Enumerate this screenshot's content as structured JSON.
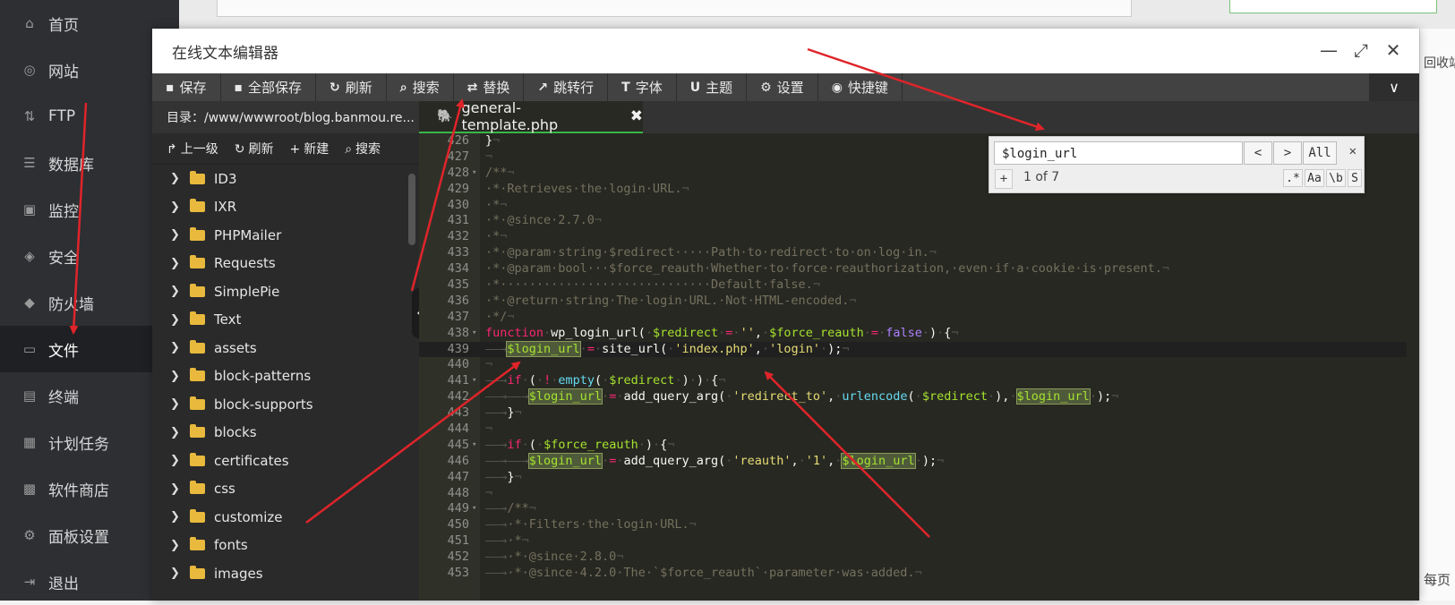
{
  "nav": [
    {
      "label": "首页",
      "icon": "home-icon",
      "glyph": "⌂"
    },
    {
      "label": "网站",
      "icon": "globe-icon",
      "glyph": "◎"
    },
    {
      "label": "FTP",
      "icon": "ftp-icon",
      "glyph": "⇅"
    },
    {
      "label": "数据库",
      "icon": "database-icon",
      "glyph": "☰"
    },
    {
      "label": "监控",
      "icon": "monitor-icon",
      "glyph": "▣"
    },
    {
      "label": "安全",
      "icon": "shield-icon",
      "glyph": "◈"
    },
    {
      "label": "防火墙",
      "icon": "firewall-icon",
      "glyph": "◆"
    },
    {
      "label": "文件",
      "icon": "folder-icon",
      "glyph": "▭"
    },
    {
      "label": "终端",
      "icon": "terminal-icon",
      "glyph": "▤"
    },
    {
      "label": "计划任务",
      "icon": "calendar-icon",
      "glyph": "▦"
    },
    {
      "label": "软件商店",
      "icon": "apps-icon",
      "glyph": "▩"
    },
    {
      "label": "面板设置",
      "icon": "gear-icon",
      "glyph": "⚙"
    },
    {
      "label": "退出",
      "icon": "logout-icon",
      "glyph": "⇥"
    }
  ],
  "window": {
    "title": "在线文本编辑器"
  },
  "toolbar": [
    {
      "label": "保存",
      "icon": "save-icon",
      "glyph": "▪"
    },
    {
      "label": "全部保存",
      "icon": "save-all-icon",
      "glyph": "▪"
    },
    {
      "label": "刷新",
      "icon": "refresh-icon",
      "glyph": "↻"
    },
    {
      "label": "搜索",
      "icon": "search-icon",
      "glyph": "⌕"
    },
    {
      "label": "替换",
      "icon": "replace-icon",
      "glyph": "⇄"
    },
    {
      "label": "跳转行",
      "icon": "goto-line-icon",
      "glyph": "↗"
    },
    {
      "label": "字体",
      "icon": "font-icon",
      "glyph": "T"
    },
    {
      "label": "主题",
      "icon": "theme-icon",
      "glyph": "U"
    },
    {
      "label": "设置",
      "icon": "settings-icon",
      "glyph": "⚙"
    },
    {
      "label": "快捷键",
      "icon": "shortcut-icon",
      "glyph": "◉"
    }
  ],
  "sidebar": {
    "dir_label": "目录：/www/wwwroot/blog.banmou.re...",
    "buttons": [
      {
        "label": "上一级",
        "icon": "up-level-icon",
        "glyph": "↱"
      },
      {
        "label": "刷新",
        "icon": "refresh-icon",
        "glyph": "↻"
      },
      {
        "label": "新建",
        "icon": "plus-icon",
        "glyph": "+"
      },
      {
        "label": "搜索",
        "icon": "search-icon",
        "glyph": "⌕"
      }
    ],
    "folders": [
      "ID3",
      "IXR",
      "PHPMailer",
      "Requests",
      "SimplePie",
      "Text",
      "assets",
      "block-patterns",
      "block-supports",
      "blocks",
      "certificates",
      "css",
      "customize",
      "fonts",
      "images"
    ]
  },
  "tab": {
    "filename": "general-template.php",
    "close": "✖"
  },
  "search": {
    "query": "$login_url",
    "count": "1 of 7",
    "prev": "<",
    "next": ">",
    "all": "All",
    "close": "✕",
    "plus": "+",
    "regex": ".*",
    "case": "Aa",
    "word": "\\b",
    "sel": "S"
  },
  "code_lines": [
    {
      "n": "426",
      "fold": "",
      "active": false,
      "t": [
        [
          "",
          "}"
        ],
        [
          "c-ws",
          "¬"
        ]
      ]
    },
    {
      "n": "427",
      "fold": "",
      "active": false,
      "t": [
        [
          "c-ws",
          "¬"
        ]
      ]
    },
    {
      "n": "428",
      "fold": "▾",
      "active": false,
      "t": [
        [
          "c-cm",
          "/**"
        ],
        [
          "c-ws",
          "¬"
        ]
      ]
    },
    {
      "n": "429",
      "fold": "",
      "active": false,
      "t": [
        [
          "c-cm",
          "·*·Retrieves·the·login·URL."
        ],
        [
          "c-ws",
          "¬"
        ]
      ]
    },
    {
      "n": "430",
      "fold": "",
      "active": false,
      "t": [
        [
          "c-cm",
          "·*"
        ],
        [
          "c-ws",
          "¬"
        ]
      ]
    },
    {
      "n": "431",
      "fold": "",
      "active": false,
      "t": [
        [
          "c-cm",
          "·*·@since·2.7.0"
        ],
        [
          "c-ws",
          "¬"
        ]
      ]
    },
    {
      "n": "432",
      "fold": "",
      "active": false,
      "t": [
        [
          "c-cm",
          "·*"
        ],
        [
          "c-ws",
          "¬"
        ]
      ]
    },
    {
      "n": "433",
      "fold": "",
      "active": false,
      "t": [
        [
          "c-cm",
          "·*·@param·string·$redirect·····Path·to·redirect·to·on·log·in."
        ],
        [
          "c-ws",
          "¬"
        ]
      ]
    },
    {
      "n": "434",
      "fold": "",
      "active": false,
      "t": [
        [
          "c-cm",
          "·*·@param·bool···$force_reauth·Whether·to·force·reauthorization,·even·if·a·cookie·is·present."
        ],
        [
          "c-ws",
          "¬"
        ]
      ]
    },
    {
      "n": "435",
      "fold": "",
      "active": false,
      "t": [
        [
          "c-cm",
          "·*·····························Default·false."
        ],
        [
          "c-ws",
          "¬"
        ]
      ]
    },
    {
      "n": "436",
      "fold": "",
      "active": false,
      "t": [
        [
          "c-cm",
          "·*·@return·string·The·login·URL.·Not·HTML-encoded."
        ],
        [
          "c-ws",
          "¬"
        ]
      ]
    },
    {
      "n": "437",
      "fold": "",
      "active": false,
      "t": [
        [
          "c-cm",
          "·*/"
        ],
        [
          "c-ws",
          "¬"
        ]
      ]
    },
    {
      "n": "438",
      "fold": "▾",
      "active": false,
      "t": [
        [
          "c-kw",
          "function"
        ],
        [
          "c-ws",
          "·"
        ],
        [
          "",
          "wp_login_url("
        ],
        [
          "c-ws",
          "·"
        ],
        [
          "c-var",
          "$redirect"
        ],
        [
          "c-ws",
          "·"
        ],
        [
          "c-kw",
          "="
        ],
        [
          "c-ws",
          "·"
        ],
        [
          "c-str",
          "''"
        ],
        [
          " ",
          ","
        ],
        [
          "c-ws",
          "·"
        ],
        [
          "c-var",
          "$force_reauth"
        ],
        [
          "c-ws",
          "·"
        ],
        [
          "c-kw",
          "="
        ],
        [
          "c-ws",
          "·"
        ],
        [
          "c-bool",
          "false"
        ],
        [
          "c-ws",
          "·"
        ],
        [
          "",
          ")"
        ],
        [
          "c-ws",
          "·"
        ],
        [
          "",
          "{"
        ],
        [
          "c-ws",
          "¬"
        ]
      ]
    },
    {
      "n": "439",
      "fold": "",
      "active": true,
      "t": [
        [
          "c-ws",
          "——→"
        ],
        [
          "c-var hl",
          "$login_url"
        ],
        [
          "c-ws",
          "·"
        ],
        [
          "c-kw",
          "="
        ],
        [
          "c-ws",
          "·"
        ],
        [
          "",
          "site_url("
        ],
        [
          "c-ws",
          "·"
        ],
        [
          "c-str",
          "'index.php'"
        ],
        [
          "",
          ","
        ],
        [
          "c-ws",
          "·"
        ],
        [
          "c-str",
          "'login'"
        ],
        [
          "c-ws",
          "·"
        ],
        [
          "",
          ");"
        ],
        [
          "c-ws",
          "¬"
        ]
      ]
    },
    {
      "n": "440",
      "fold": "",
      "active": false,
      "t": [
        [
          "c-ws",
          "¬"
        ]
      ]
    },
    {
      "n": "441",
      "fold": "▾",
      "active": false,
      "t": [
        [
          "c-ws",
          "——→"
        ],
        [
          "c-kw",
          "if"
        ],
        [
          "c-ws",
          "·"
        ],
        [
          "",
          "("
        ],
        [
          "c-ws",
          "·"
        ],
        [
          "c-kw",
          "!"
        ],
        [
          "c-ws",
          "·"
        ],
        [
          "c-fn",
          "empty"
        ],
        [
          "",
          "("
        ],
        [
          "c-ws",
          "·"
        ],
        [
          "c-var",
          "$redirect"
        ],
        [
          "c-ws",
          "·"
        ],
        [
          "",
          ")"
        ],
        [
          "c-ws",
          "·"
        ],
        [
          "",
          ")"
        ],
        [
          "c-ws",
          "·"
        ],
        [
          "",
          "{"
        ],
        [
          "c-ws",
          "¬"
        ]
      ]
    },
    {
      "n": "442",
      "fold": "",
      "active": false,
      "t": [
        [
          "c-ws",
          "——→——→"
        ],
        [
          "c-var hl",
          "$login_url"
        ],
        [
          "c-ws",
          "·"
        ],
        [
          "c-kw",
          "="
        ],
        [
          "c-ws",
          "·"
        ],
        [
          "",
          "add_query_arg("
        ],
        [
          "c-ws",
          "·"
        ],
        [
          "c-str",
          "'redirect_to'"
        ],
        [
          "",
          ","
        ],
        [
          "c-ws",
          "·"
        ],
        [
          "c-fn",
          "urlencode"
        ],
        [
          "",
          "("
        ],
        [
          "c-ws",
          "·"
        ],
        [
          "c-var",
          "$redirect"
        ],
        [
          "c-ws",
          "·"
        ],
        [
          "",
          ")"
        ],
        [
          "",
          ","
        ],
        [
          "c-ws",
          "·"
        ],
        [
          "c-var hl",
          "$login_url"
        ],
        [
          "c-ws",
          "·"
        ],
        [
          "",
          ");"
        ],
        [
          "c-ws",
          "¬"
        ]
      ]
    },
    {
      "n": "443",
      "fold": "",
      "active": false,
      "t": [
        [
          "c-ws",
          "——→"
        ],
        [
          "",
          "}"
        ],
        [
          "c-ws",
          "¬"
        ]
      ]
    },
    {
      "n": "444",
      "fold": "",
      "active": false,
      "t": [
        [
          "c-ws",
          "¬"
        ]
      ]
    },
    {
      "n": "445",
      "fold": "▾",
      "active": false,
      "t": [
        [
          "c-ws",
          "——→"
        ],
        [
          "c-kw",
          "if"
        ],
        [
          "c-ws",
          "·"
        ],
        [
          "",
          "("
        ],
        [
          "c-ws",
          "·"
        ],
        [
          "c-var",
          "$force_reauth"
        ],
        [
          "c-ws",
          "·"
        ],
        [
          "",
          ")"
        ],
        [
          "c-ws",
          "·"
        ],
        [
          "",
          "{"
        ],
        [
          "c-ws",
          "¬"
        ]
      ]
    },
    {
      "n": "446",
      "fold": "",
      "active": false,
      "t": [
        [
          "c-ws",
          "——→——→"
        ],
        [
          "c-var hl",
          "$login_url"
        ],
        [
          "c-ws",
          "·"
        ],
        [
          "c-kw",
          "="
        ],
        [
          "c-ws",
          "·"
        ],
        [
          "",
          "add_query_arg("
        ],
        [
          "c-ws",
          "·"
        ],
        [
          "c-str",
          "'reauth'"
        ],
        [
          "",
          ","
        ],
        [
          "c-ws",
          "·"
        ],
        [
          "c-str",
          "'1'"
        ],
        [
          "",
          ","
        ],
        [
          "c-ws",
          "·"
        ],
        [
          "c-var hl",
          "$login_url"
        ],
        [
          "c-ws",
          "·"
        ],
        [
          "",
          ");"
        ],
        [
          "c-ws",
          "¬"
        ]
      ]
    },
    {
      "n": "447",
      "fold": "",
      "active": false,
      "t": [
        [
          "c-ws",
          "——→"
        ],
        [
          "",
          "}"
        ],
        [
          "c-ws",
          "¬"
        ]
      ]
    },
    {
      "n": "448",
      "fold": "",
      "active": false,
      "t": [
        [
          "c-ws",
          "¬"
        ]
      ]
    },
    {
      "n": "449",
      "fold": "▾",
      "active": false,
      "t": [
        [
          "c-ws",
          "——→"
        ],
        [
          "c-cm",
          "/**"
        ],
        [
          "c-ws",
          "¬"
        ]
      ]
    },
    {
      "n": "450",
      "fold": "",
      "active": false,
      "t": [
        [
          "c-ws",
          "——→"
        ],
        [
          "c-cm",
          "·*·Filters·the·login·URL."
        ],
        [
          "c-ws",
          "¬"
        ]
      ]
    },
    {
      "n": "451",
      "fold": "",
      "active": false,
      "t": [
        [
          "c-ws",
          "——→"
        ],
        [
          "c-cm",
          "·*"
        ],
        [
          "c-ws",
          "¬"
        ]
      ]
    },
    {
      "n": "452",
      "fold": "",
      "active": false,
      "t": [
        [
          "c-ws",
          "——→"
        ],
        [
          "c-cm",
          "·*·@since·2.8.0"
        ],
        [
          "c-ws",
          "¬"
        ]
      ]
    },
    {
      "n": "453",
      "fold": "",
      "active": false,
      "t": [
        [
          "c-ws",
          "——→"
        ],
        [
          "c-cm",
          "·*·@since·4.2.0·The·`$force_reauth`·parameter·was·added."
        ],
        [
          "c-ws",
          "¬"
        ]
      ]
    }
  ],
  "background": {
    "right_text_1": "回收站",
    "right_text_2": "每页"
  },
  "colors": {
    "accent_green": "#3ab54a",
    "arrow_red": "#e0242a",
    "toolbar_bg": "#424242",
    "nav_bg": "#2d2f33",
    "editor_bg": "#272822"
  }
}
